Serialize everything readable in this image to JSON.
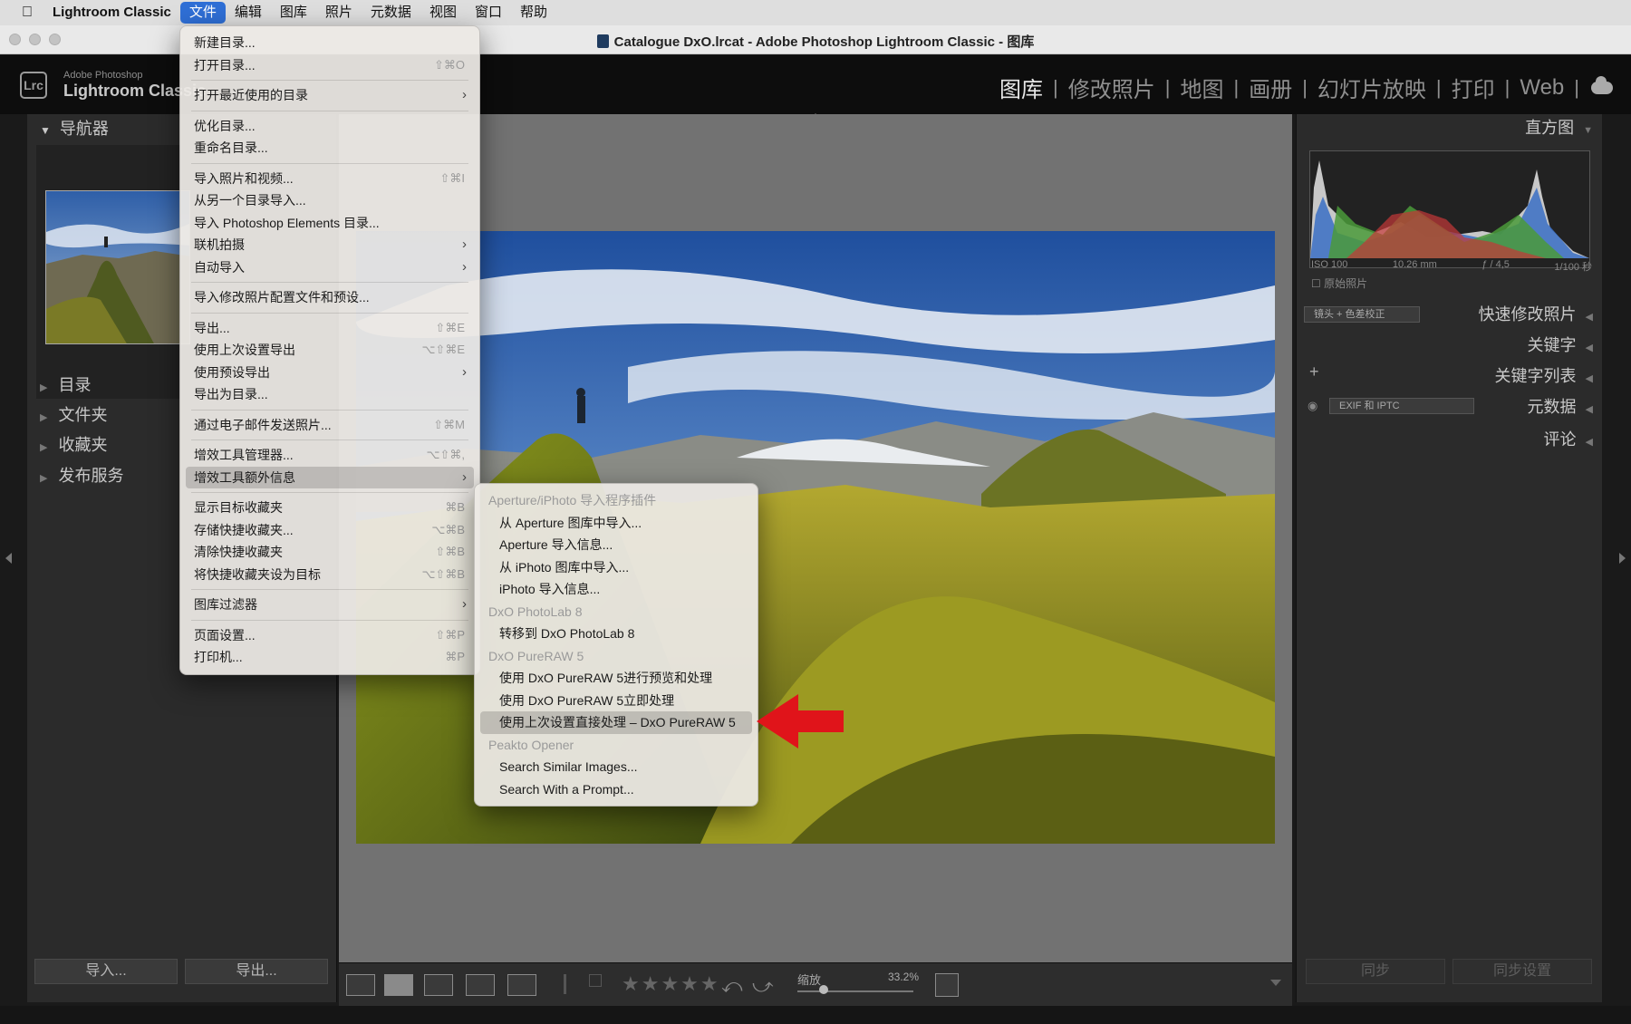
{
  "menubar": {
    "app": "Lightroom Classic",
    "items": [
      "文件",
      "编辑",
      "图库",
      "照片",
      "元数据",
      "视图",
      "窗口",
      "帮助"
    ]
  },
  "window": {
    "title": "Catalogue DxO.lrcat - Adobe Photoshop Lightroom Classic - 图库"
  },
  "identity": {
    "badge": "Lrc",
    "sub": "Adobe Photoshop",
    "main": "Lightroom Classic"
  },
  "modules": [
    "图库",
    "修改照片",
    "地图",
    "画册",
    "幻灯片放映",
    "打印",
    "Web"
  ],
  "left_panel": {
    "navigator": "导航器",
    "sections": [
      "目录",
      "文件夹",
      "收藏夹",
      "发布服务"
    ],
    "import_btn": "导入...",
    "export_btn": "导出..."
  },
  "right_panel": {
    "histogram": "直方图",
    "iso": "ISO 100",
    "focal": "10.26 mm",
    "aperture": "ƒ / 4,5",
    "shutter": "1/100 秒",
    "original": "原始照片",
    "quick_preset": "镜头 + 色差校正",
    "quick_develop": "快速修改照片",
    "keywording": "关键字",
    "keyword_list": "关键字列表",
    "metadata_preset": "EXIF 和 IPTC",
    "metadata": "元数据",
    "comments": "评论",
    "sync_btn": "同步",
    "sync_settings_btn": "同步设置"
  },
  "toolbar": {
    "zoom_label": "缩放",
    "zoom_value": "33.2%"
  },
  "file_menu": {
    "new_catalog": "新建目录...",
    "open_catalog": "打开目录...",
    "open_catalog_sc": "⇧⌘O",
    "open_recent": "打开最近使用的目录",
    "optimize": "优化目录...",
    "rename": "重命名目录...",
    "import_photos": "导入照片和视频...",
    "import_photos_sc": "⇧⌘I",
    "import_from_catalog": "从另一个目录导入...",
    "import_pse": "导入 Photoshop Elements 目录...",
    "tethered": "联机拍摄",
    "auto_import": "自动导入",
    "import_profiles": "导入修改照片配置文件和预设...",
    "export": "导出...",
    "export_sc": "⇧⌘E",
    "export_previous": "使用上次设置导出",
    "export_previous_sc": "⌥⇧⌘E",
    "export_preset": "使用预设导出",
    "export_catalog": "导出为目录...",
    "email": "通过电子邮件发送照片...",
    "email_sc": "⇧⌘M",
    "plugin_manager": "增效工具管理器...",
    "plugin_manager_sc": "⌥⇧⌘,",
    "plugin_extras": "增效工具额外信息",
    "show_target": "显示目标收藏夹",
    "show_target_sc": "⌘B",
    "save_quick": "存储快捷收藏夹...",
    "save_quick_sc": "⌥⌘B",
    "clear_quick": "清除快捷收藏夹",
    "clear_quick_sc": "⇧⌘B",
    "set_quick_target": "将快捷收藏夹设为目标",
    "set_quick_target_sc": "⌥⇧⌘B",
    "library_filters": "图库过滤器",
    "page_setup": "页面设置...",
    "page_setup_sc": "⇧⌘P",
    "printer": "打印机...",
    "printer_sc": "⌘P"
  },
  "plugin_submenu": {
    "hdr_aperture": "Aperture/iPhoto 导入程序插件",
    "aperture_import": "从 Aperture 图库中导入...",
    "aperture_info": "Aperture 导入信息...",
    "iphoto_import": "从 iPhoto 图库中导入...",
    "iphoto_info": "iPhoto 导入信息...",
    "hdr_photolab": "DxO PhotoLab 8",
    "transfer_photolab": "转移到 DxO PhotoLab 8",
    "hdr_pureraw": "DxO PureRAW 5",
    "pureraw_preview": "使用 DxO PureRAW 5进行预览和处理",
    "pureraw_now": "使用 DxO PureRAW 5立即处理",
    "pureraw_last": "使用上次设置直接处理 – DxO PureRAW 5",
    "hdr_peakto": "Peakto Opener",
    "search_similar": "Search Similar Images...",
    "search_prompt": "Search With a Prompt..."
  },
  "colors": {
    "menu_highlight": "#2f6fd6",
    "arrow": "#e0141a"
  }
}
